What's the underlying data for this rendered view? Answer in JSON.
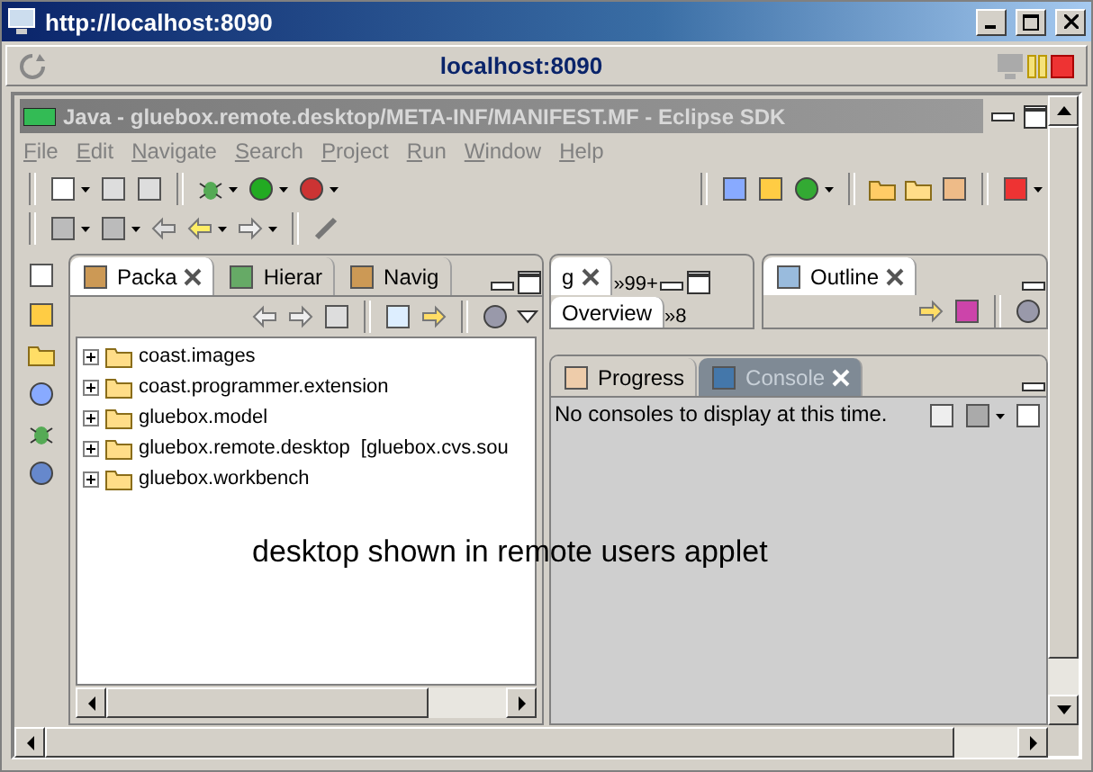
{
  "browser_window": {
    "title": "http://localhost:8090"
  },
  "applet_bar": {
    "title": "localhost:8090"
  },
  "eclipse_window": {
    "title": "Java - gluebox.remote.desktop/META-INF/MANIFEST.MF - Eclipse SDK",
    "active": false
  },
  "menu": [
    "File",
    "Edit",
    "Navigate",
    "Search",
    "Project",
    "Run",
    "Window",
    "Help"
  ],
  "package_explorer": {
    "tabs": [
      {
        "label": "Packa",
        "selected": true
      },
      {
        "label": "Hierar",
        "selected": false
      },
      {
        "label": "Navig",
        "selected": false
      }
    ],
    "projects": [
      {
        "name": "coast.images",
        "expanded": false
      },
      {
        "name": "coast.programmer.extension",
        "expanded": false
      },
      {
        "name": "gluebox.model",
        "expanded": false
      },
      {
        "name": "gluebox.remote.desktop",
        "decoration": "[gluebox.cvs.sou",
        "expanded": false
      },
      {
        "name": "gluebox.workbench",
        "expanded": false
      }
    ]
  },
  "editor": {
    "tab": "g",
    "overflow": "»99+",
    "overview_tab": "Overview",
    "overview_overflow": "»8"
  },
  "outline": {
    "tab": "Outline"
  },
  "console_panel": {
    "tabs": [
      {
        "label": "Progress",
        "selected": false
      },
      {
        "label": "Console",
        "selected": true
      }
    ],
    "message": "No consoles to display at this time."
  },
  "caption": "desktop shown in remote users applet"
}
